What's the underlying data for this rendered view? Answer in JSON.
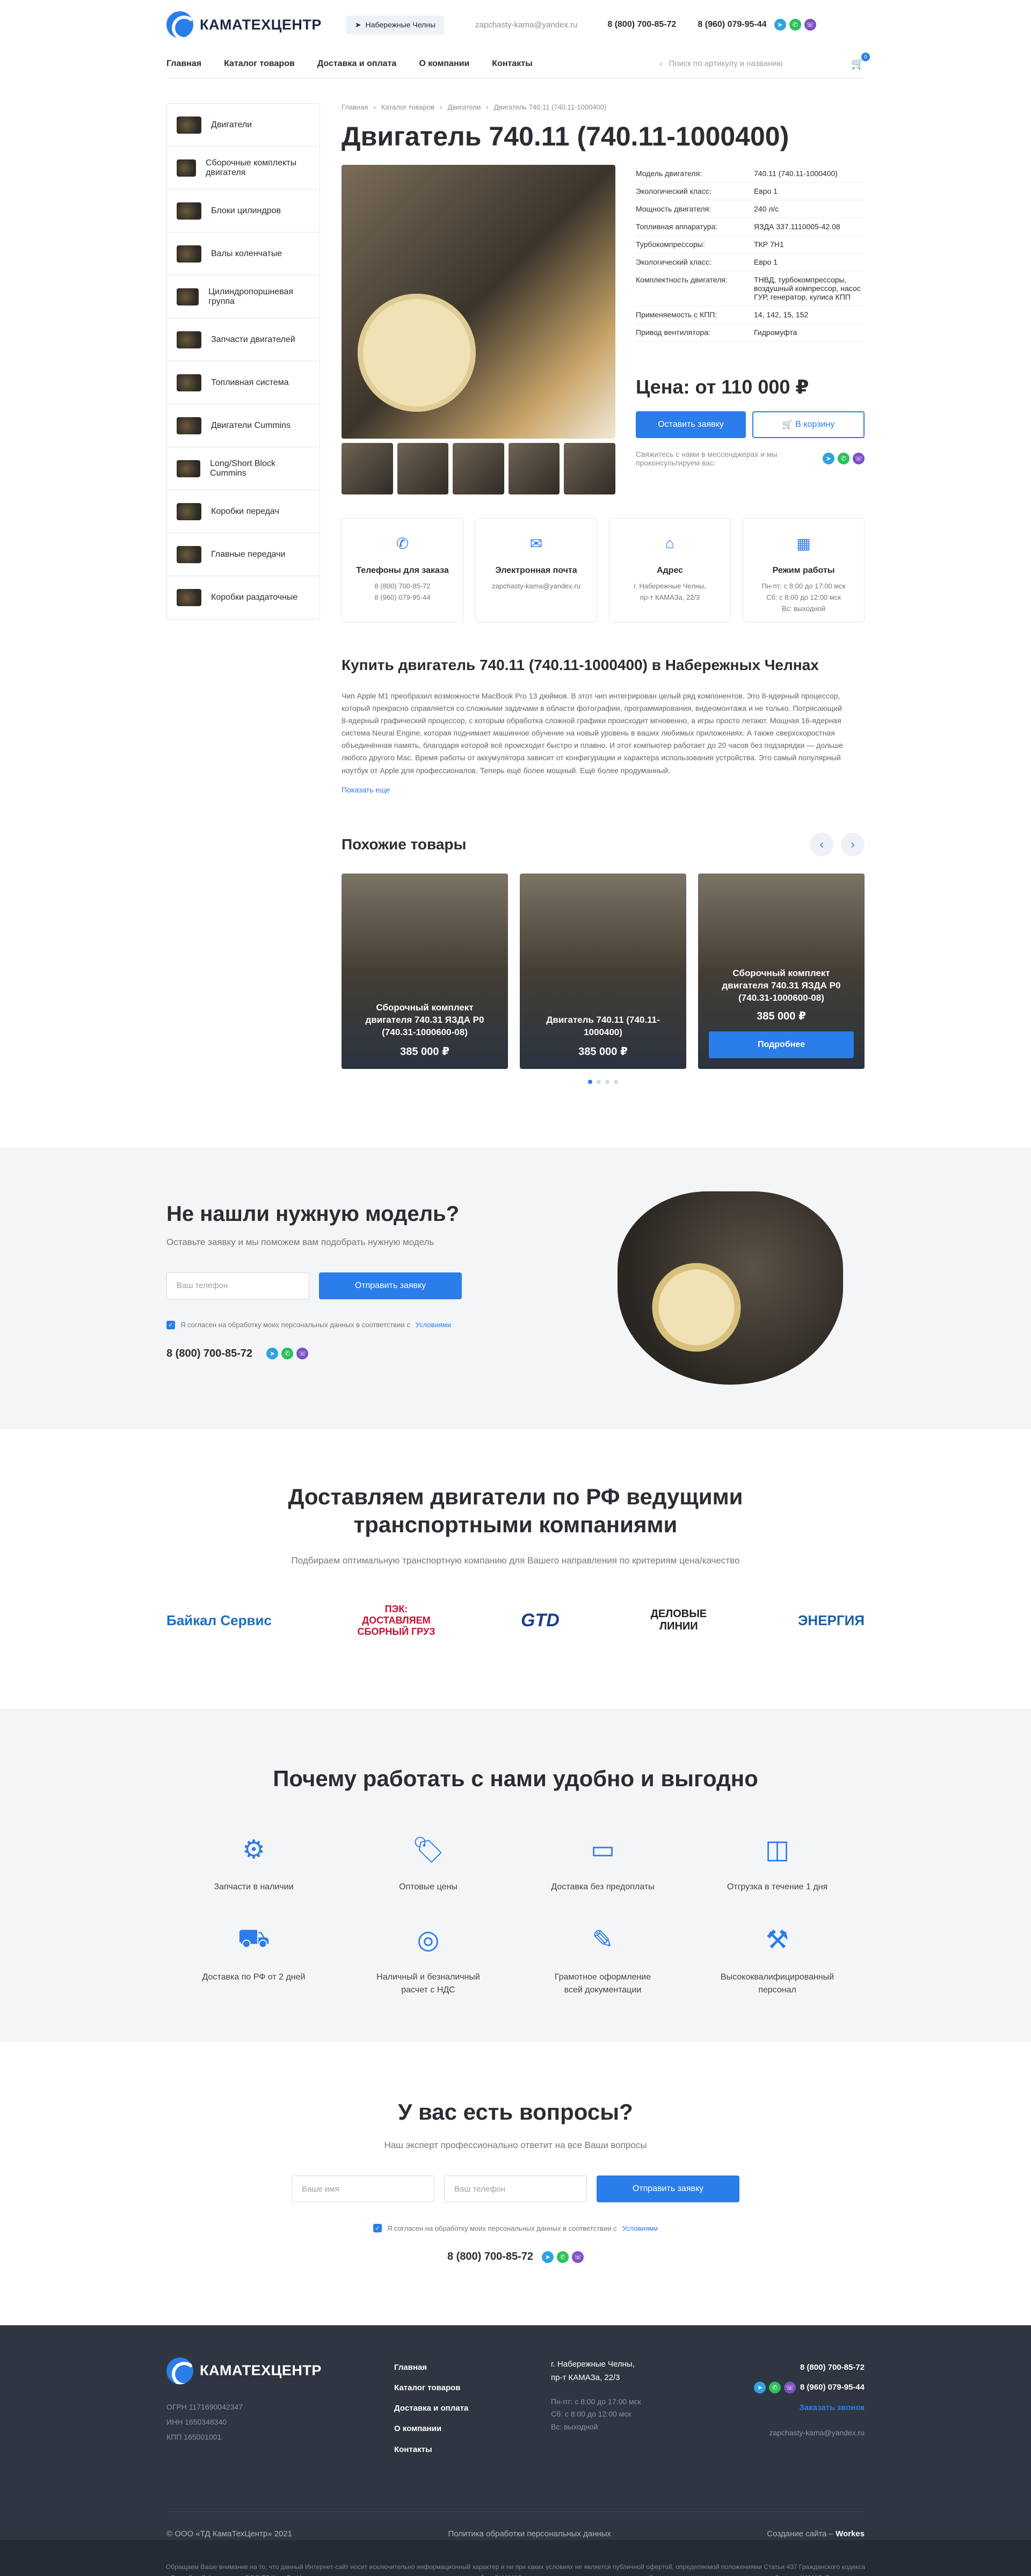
{
  "header": {
    "logo": "КАМАТЕХЦЕНТР",
    "city": "Набережные Челны",
    "email": "zapchasty-kama@yandex.ru",
    "phone1": "8 (800) 700-85-72",
    "phone2": "8 (960) 079-95-44"
  },
  "nav": [
    "Главная",
    "Каталог товаров",
    "Доставка и оплата",
    "О компании",
    "Контакты"
  ],
  "search_placeholder": "Поиск по артикулу и названию",
  "cart_count": "0",
  "sidebar": [
    "Двигатели",
    "Сборочные комплекты двигателя",
    "Блоки цилиндров",
    "Валы коленчатые",
    "Цилиндропоршневая группа",
    "Запчасти двигателей",
    "Топливная система",
    "Двигатели Cummins",
    "Long/Short Block Cummins",
    "Коробки передач",
    "Главные передачи",
    "Коробки раздаточные"
  ],
  "breadcrumbs": [
    "Главная",
    "Каталог товаров",
    "Двигатели",
    "Двигатель 740.11 (740.11-1000400)"
  ],
  "product": {
    "title": "Двигатель 740.11 (740.11-1000400)",
    "price": "Цена: от 110 000 ₽",
    "order": "Оставить заявку",
    "cart": "В корзину",
    "messenger_note": "Свяжитесь с нами в мессенджерах и мы проконсультируем вас:"
  },
  "specs": [
    [
      "Модель двигателя:",
      "740.11 (740.11-1000400)"
    ],
    [
      "Экологический класс:",
      "Евро 1"
    ],
    [
      "Мощность двигателя:",
      "240 л/с"
    ],
    [
      "Топливная аппаратура:",
      "ЯЗДА 337.1110005-42.08"
    ],
    [
      "Турбокомпрессоры:",
      "ТКР 7Н1"
    ],
    [
      "Экологический класс:",
      "Евро 1"
    ],
    [
      "Комплектность двигателя:",
      "ТНВД, турбокомпрессоры, воздушный компрессор, насос ГУР, генератор, кулиса КПП"
    ],
    [
      "Применяемость с КПП:",
      "14, 142, 15, 152"
    ],
    [
      "Привод вентилятора:",
      "Гидромуфта"
    ]
  ],
  "contacts": [
    {
      "title": "Телефоны для заказа",
      "text": "8 (800) 700-85-72\n8 (960) 079-95-44"
    },
    {
      "title": "Электронная почта",
      "text": "zapchasty-kama@yandex.ru"
    },
    {
      "title": "Адрес",
      "text": "г. Набережные Челны,\nпр-т КАМАЗа, 22/3"
    },
    {
      "title": "Режим работы",
      "text": "Пн-пт: с 8:00 до 17:00 мск\nСб: с 8:00 до 12:00 мск\nВс: выходной"
    }
  ],
  "about": {
    "title": "Купить двигатель 740.11 (740.11-1000400) в Набережных Челнах",
    "text": "Чип Apple M1 преобразил возможности MacBook Pro 13 дюймов. В этот чип интегрирован целый ряд компонентов. Это 8‑ядерный процессор, который прекрасно справляется со сложными задачами в области фотографии, программирования, видеомонтажа и не только. Потрясающий 8‑ядерный графический процессор, с которым обработка сложной графики происходит мгновенно, а игры просто летают. Мощная 16‑ядерная система Neural Engine, которая поднимает машинное обучение на новый уровень в ваших любимых приложениях. А также сверхскоростная объединённая память, благодаря которой всё происходит быстро и плавно. И этот компьютер работает до 20 часов без подзарядки — дольше любого другого Mac. Время работы от аккумулятора зависит от конфигурации и характера использования устройства. Это самый популярный ноутбук от Apple для профессионалов. Теперь ещё более мощный. Ещё более продуманный.",
    "more": "Показать еще"
  },
  "similar": {
    "title": "Похожие товары",
    "items": [
      {
        "name": "Сборочный комплект двигателя 740.31 ЯЗДА Р0 (740.31-1000600-08)",
        "price": "385 000 ₽"
      },
      {
        "name": "Двигатель 740.11 (740.11-1000400)",
        "price": "385 000 ₽"
      },
      {
        "name": "Сборочный комплект двигателя 740.31 ЯЗДА Р0 (740.31-1000600-08)",
        "price": "385 000 ₽",
        "button": "Подробнее"
      }
    ]
  },
  "notfound": {
    "title": "Не нашли нужную модель?",
    "subtitle": "Оставьте заявку и мы поможем вам подобрать нужную модель",
    "phone_placeholder": "Ваш телефон",
    "submit": "Отправить заявку",
    "agree": "Я согласен на обработку моих персональных данных в соответствии с",
    "agree_link": "Условиями",
    "phone": "8 (800) 700-85-72"
  },
  "delivery": {
    "title": "Доставляем двигатели по РФ ведущими транспортными компаниями",
    "subtitle": "Подбираем оптимальную транспортную компанию для Вашего направления по критериям цена/качество",
    "logos": [
      "Байкал Сервис",
      "ПЭК: ДОСТАВЛЯЕМ СБОРНЫЙ ГРУЗ",
      "GTD",
      "ДЕЛОВЫЕ ЛИНИИ",
      "ЭНЕРГИЯ"
    ]
  },
  "why": {
    "title": "Почему работать с нами удобно и выгодно",
    "items": [
      "Запчасти в наличии",
      "Оптовые цены",
      "Доставка без предоплаты",
      "Отгрузка в течение 1 дня",
      "Доставка по РФ от 2 дней",
      "Наличный и безналичный\nрасчет с НДС",
      "Грамотное оформление\nвсей документации",
      "Высококвалифицированный\nперсонал"
    ]
  },
  "qa": {
    "title": "У вас есть вопросы?",
    "subtitle": "Наш эксперт профессионально ответит на все Ваши вопросы",
    "name_placeholder": "Ваше имя",
    "phone_placeholder": "Ваш телефон",
    "submit": "Отправить заявку",
    "agree": "Я согласен на обработку моих персональных данных в соответствии с",
    "agree_link": "Условиями",
    "phone": "8 (800) 700-85-72"
  },
  "footer": {
    "logo": "КАМАТЕХЦЕНТР",
    "ogrn": "ОГРН 1171690042347",
    "inn": "ИНН 1650348340",
    "kpp": "КПП 165001001",
    "nav": [
      "Главная",
      "Каталог товаров",
      "Доставка и оплата",
      "О компании",
      "Контакты"
    ],
    "address": "г. Набережные Челны,\nпр-т КАМАЗа, 22/3",
    "hours": "Пн-пт: с 8:00 до 17:00 мск\nСб: с 8:00 до 12:00 мск\nВс: выходной",
    "phone1": "8 (800) 700-85-72",
    "phone2": "8 (960) 079-95-44",
    "callback": "Заказать звонок",
    "email": "zapchasty-kama@yandex.ru",
    "copyright": "© ООО «ТД КамаТехЦентр» 2021",
    "policy": "Политика обработки персональных данных",
    "dev_label": "Создание сайта –",
    "dev": "Workes",
    "legal": "Обращаем Ваше внимание на то, что данный Интернет-сайт носит исключительно информационный характер и ни при каких условиях не является публичной офертой, определяемой положениями Статьи 437 Гражданского кодекса Российской Федерации. ООО ТД КамаТехЦентр предлагает оригинальные запасные части для автомобилей КАМАЗ, а также продукцию заводов-изготовителей, которые не имеют отношения к торговой марке КАМАЗ. Все товары приобретены официально, при этом ООО ТД КамаТехЦентр не является официальным дилером ПАО Камаз. Упоминание КАМАЗ на данном сайте говорит о принадлежности представленных запчастей к автомобилям марки КАМАЗ."
  }
}
